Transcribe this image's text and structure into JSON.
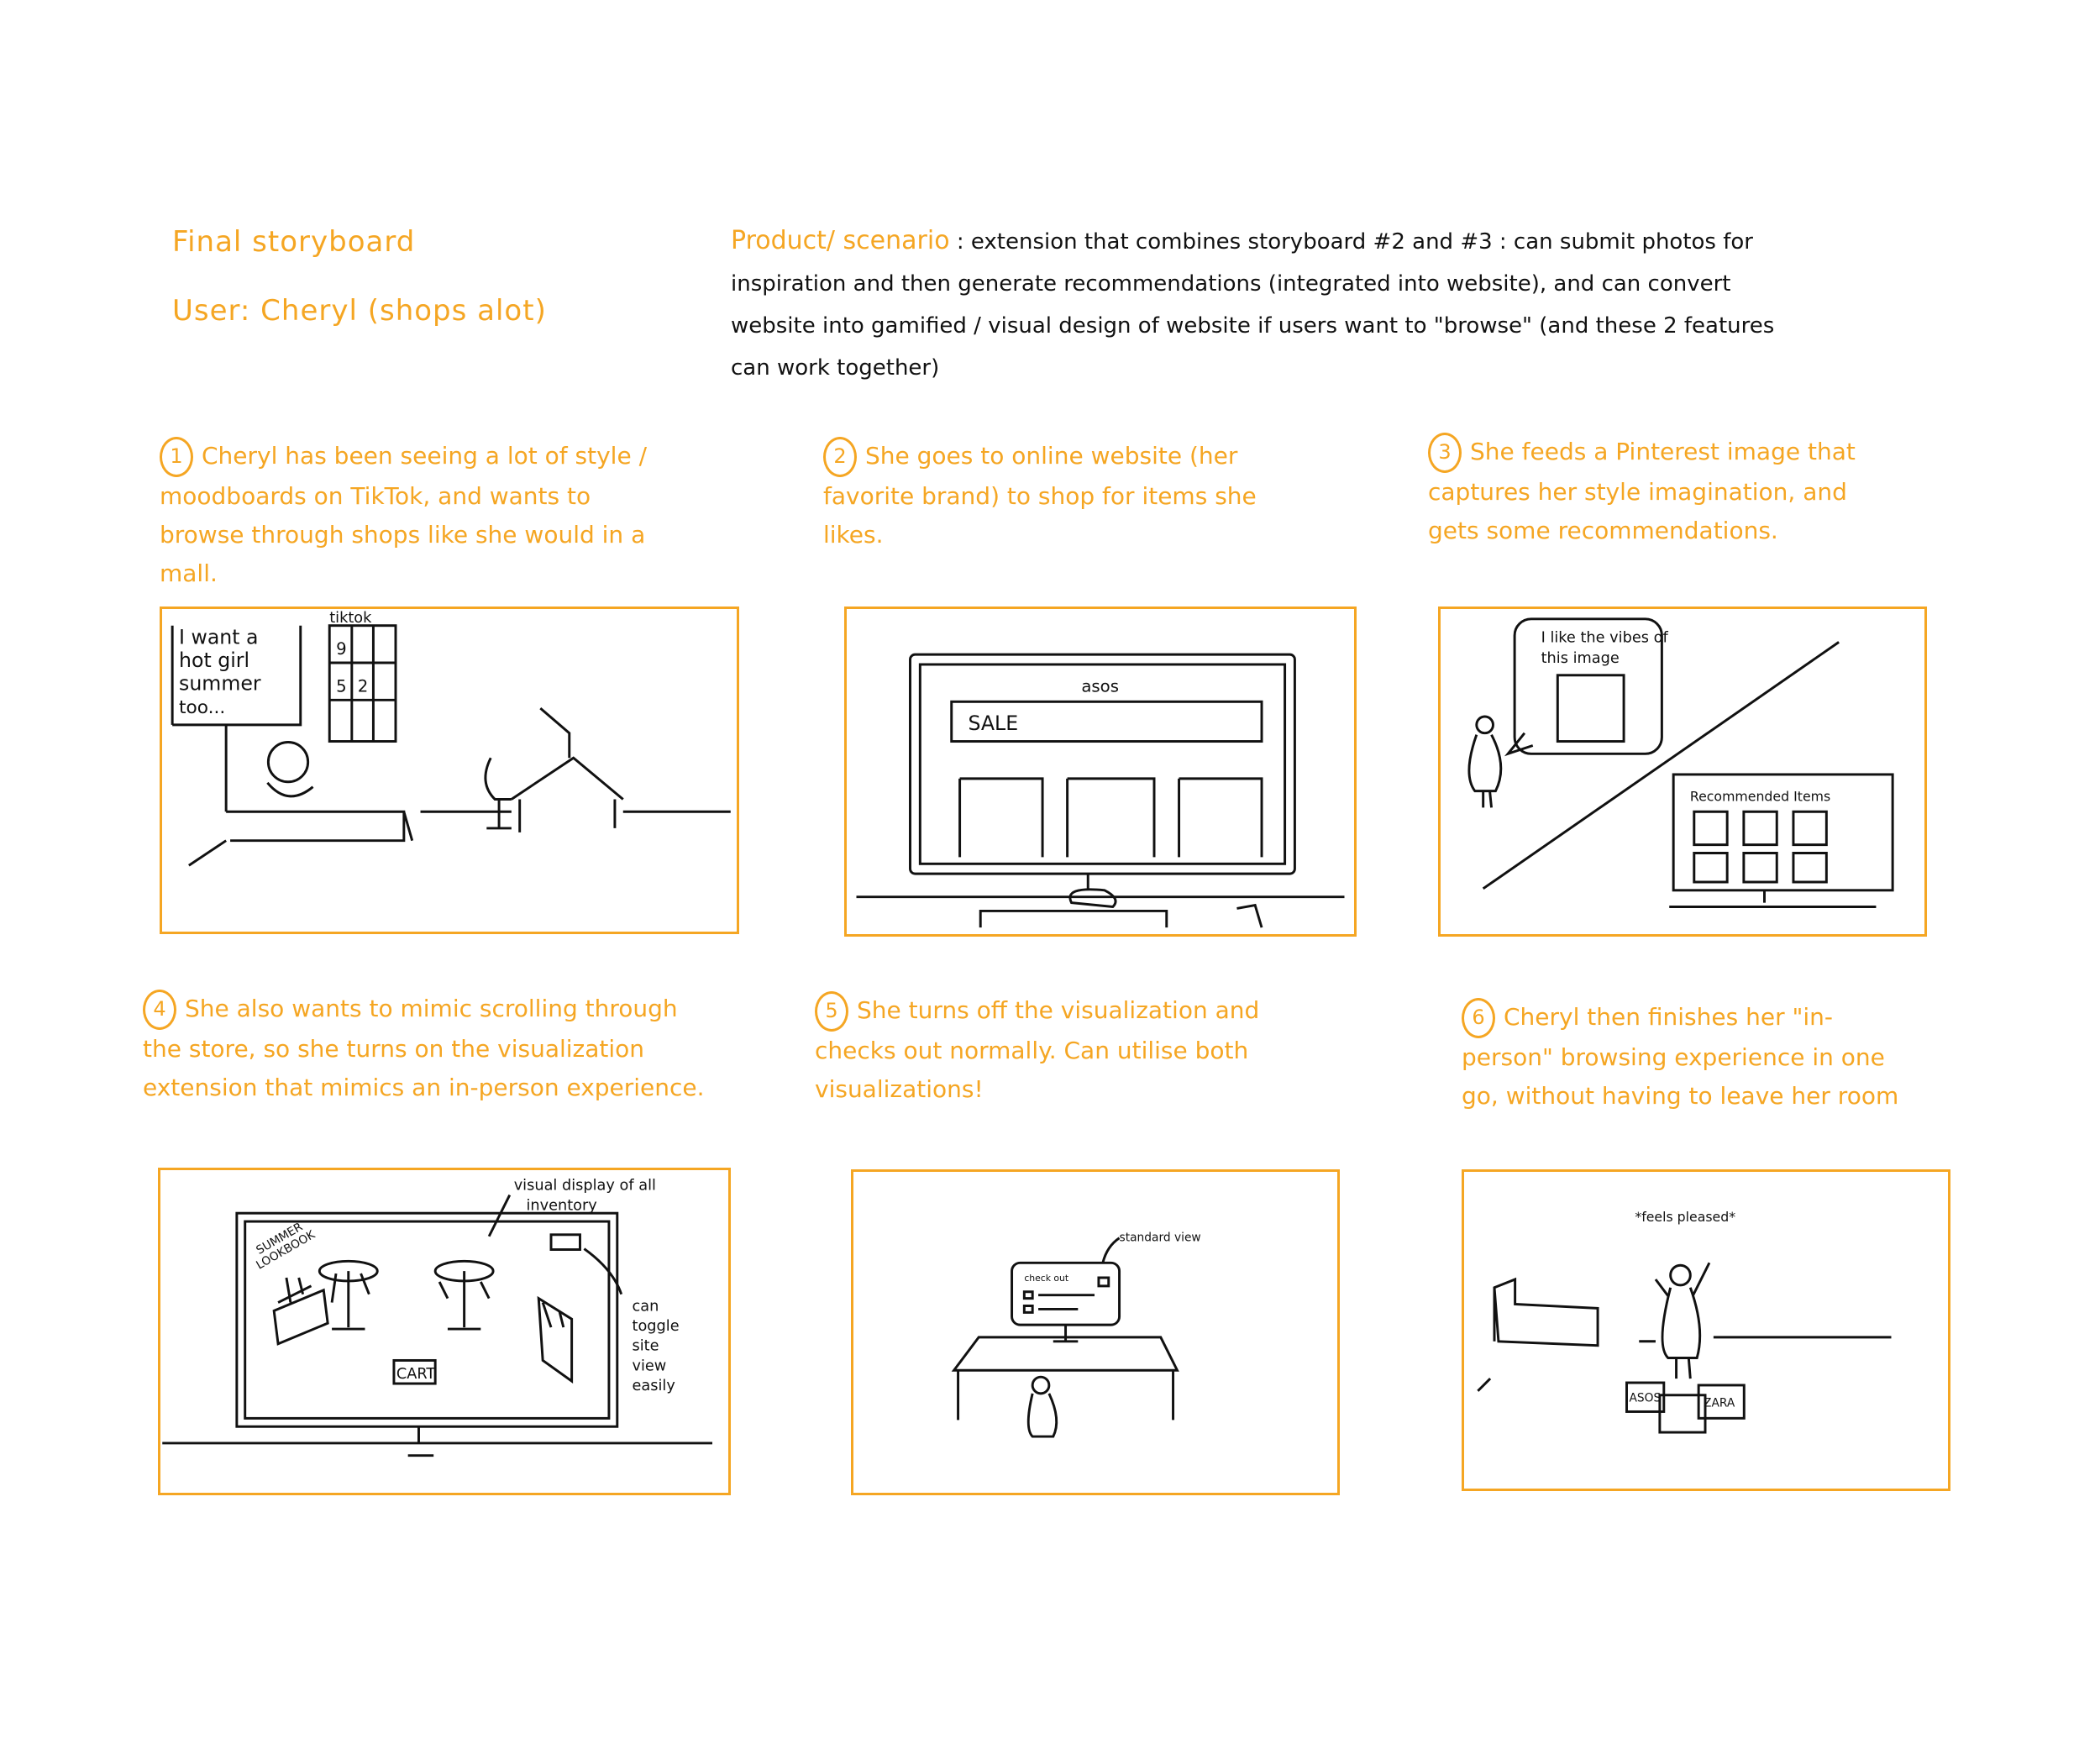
{
  "header": {
    "title": "Final storyboard",
    "user": "User: Cheryl (shops alot)",
    "scenario_label": "Product/ scenario",
    "scenario_text": ": extension that combines storyboard #2 and #3 : can submit photos for inspiration and then generate recommendations (integrated into website), and can convert website into gamified / visual design of website if users want to \"browse\" (and these 2 features can work together)"
  },
  "steps": [
    {
      "num": "1",
      "text": "Cheryl has been seeing a lot of style / moodboards on TikTok, and wants to browse through shops like she would in a mall."
    },
    {
      "num": "2",
      "text": "She goes to online website (her favorite brand) to shop for items she likes."
    },
    {
      "num": "3",
      "text": "She feeds a Pinterest image that captures her style imagination, and gets some recommendations."
    },
    {
      "num": "4",
      "text": "She also wants to mimic scrolling through the store, so she turns on the visualization extension that mimics an in-person experience."
    },
    {
      "num": "5",
      "text": "She turns off the visualization and checks out normally. Can utilise both visualizations!"
    },
    {
      "num": "6",
      "text": "Cheryl then finishes her \"in-person\" browsing experience in one go, without having to leave her room"
    }
  ],
  "panels": {
    "p1": {
      "speech": [
        "I want a",
        "hot girl",
        "summer",
        "too..."
      ],
      "app": "tiktok",
      "grid": [
        "9",
        "5",
        "2"
      ]
    },
    "p2": {
      "site": "asos",
      "banner": "SALE"
    },
    "p3": {
      "speech": [
        "I like the vibes of",
        "this image"
      ],
      "screen_title": "Recommended Items"
    },
    "p4": {
      "callout1": [
        "visual display of all",
        "inventory"
      ],
      "callout2": [
        "can",
        "toggle",
        "site",
        "view",
        "easily"
      ],
      "rack": [
        "SUMMER",
        "LOOKBOOK"
      ],
      "cart": "CART"
    },
    "p5": {
      "callout": "standard view",
      "screen": "check out"
    },
    "p6": {
      "caption": "*feels pleased*",
      "bag1": "ASOS",
      "bag2": "ZARA"
    }
  },
  "colors": {
    "accent": "#F5A623",
    "ink": "#111111"
  }
}
